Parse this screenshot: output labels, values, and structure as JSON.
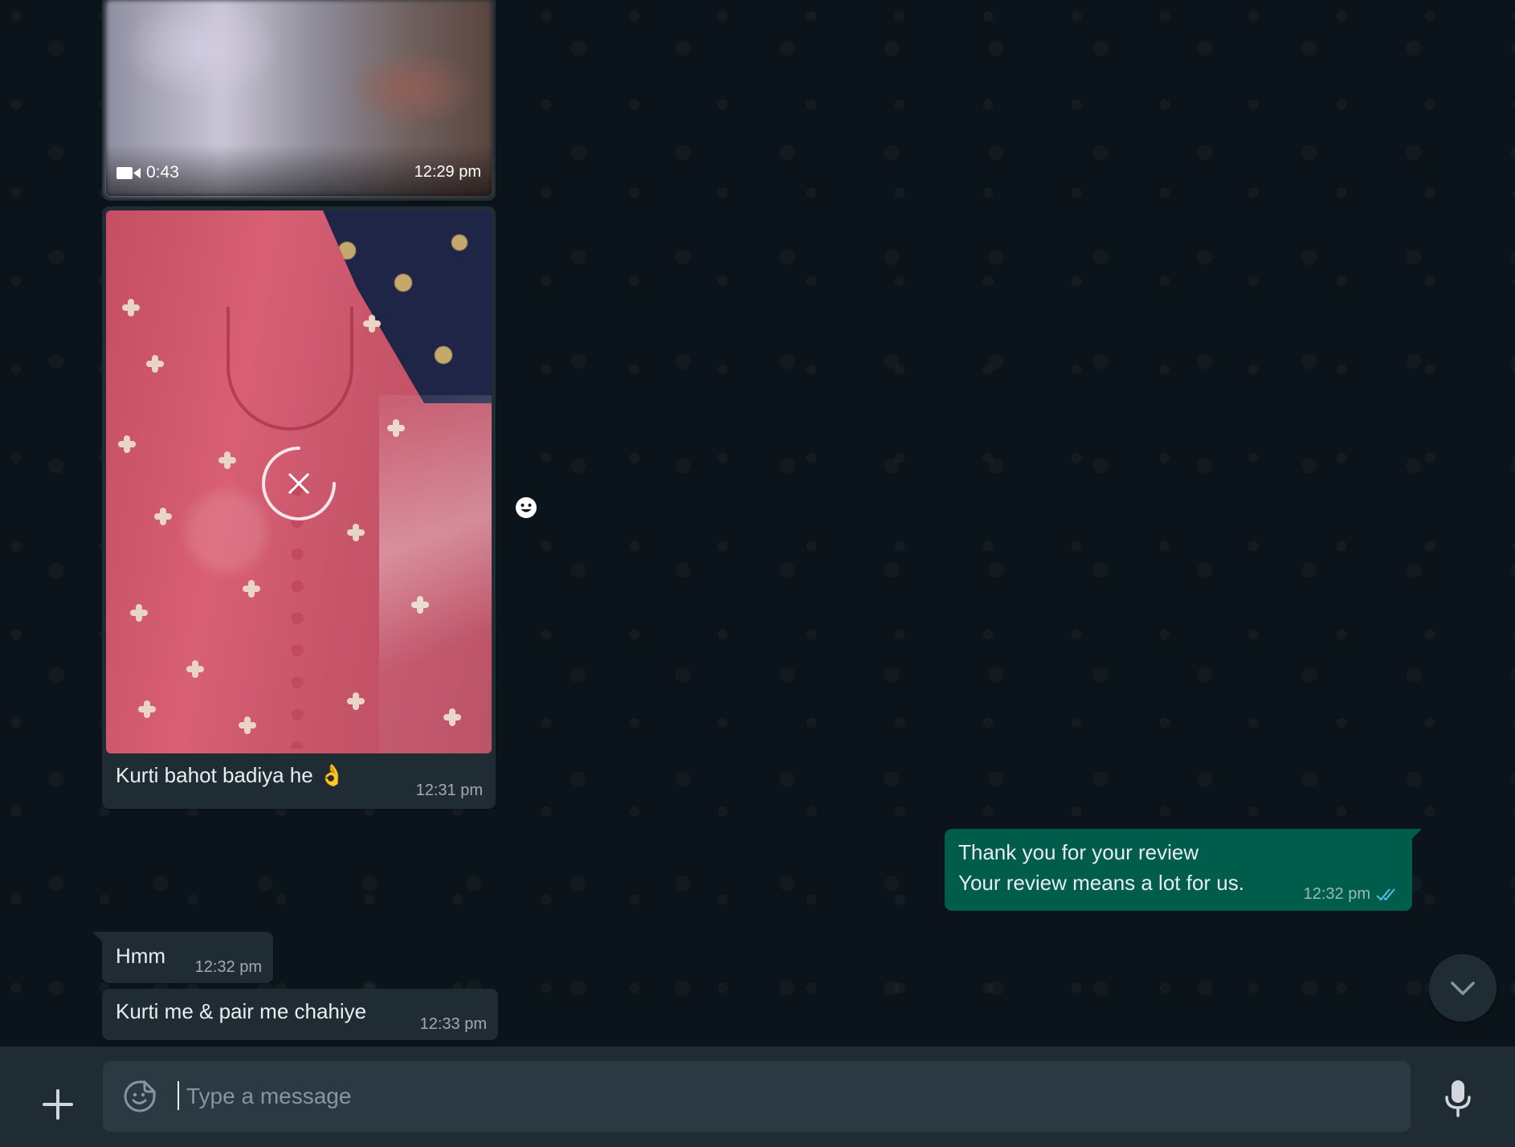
{
  "colors": {
    "background": "#0b141a",
    "incoming_bubble": "#202c33",
    "outgoing_bubble": "#005c4b",
    "footer": "#202c33",
    "input": "#2a3942",
    "read_ticks": "#53bdeb"
  },
  "messages": {
    "video": {
      "icon": "video-camera-icon",
      "duration": "0:43",
      "time": "12:29 pm"
    },
    "image": {
      "caption": "Kurti bahot badiya he",
      "caption_emoji": "👌",
      "time": "12:31 pm",
      "overlay_icon": "cancel-download-icon"
    },
    "outgoing": {
      "line1": "Thank you for your review",
      "line2": "Your review means a lot for us.",
      "time": "12:32 pm",
      "status_icon": "double-check-read-icon"
    },
    "hmm": {
      "text": "Hmm",
      "time": "12:32 pm"
    },
    "kurti_pair": {
      "text": "Kurti me & pair me chahiye",
      "time": "12:33 pm"
    }
  },
  "composer": {
    "placeholder": "Type a message",
    "value": "",
    "attach_icon": "plus-icon",
    "sticker_icon": "sticker-icon",
    "mic_icon": "microphone-icon"
  },
  "controls": {
    "react_icon": "smiley-icon",
    "scroll_icon": "chevron-down-icon"
  }
}
